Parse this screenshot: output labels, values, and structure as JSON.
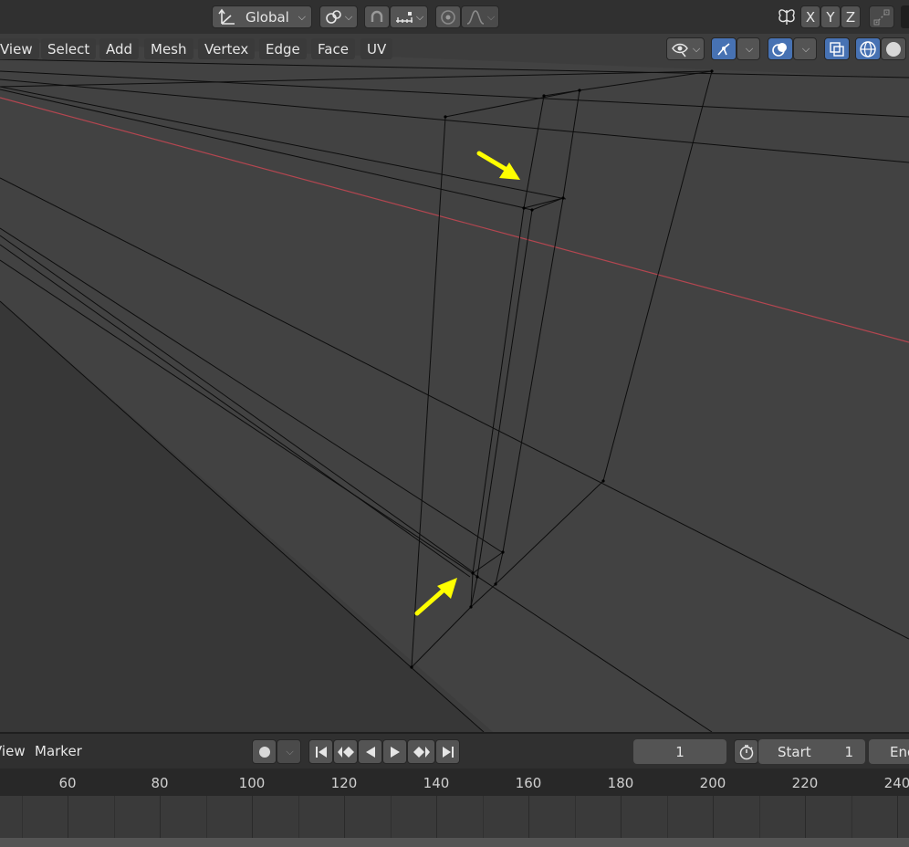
{
  "header": {
    "transform_orientation": "Global",
    "axis_x": "X",
    "axis_y": "Y",
    "axis_z": "Z"
  },
  "menu": {
    "items": [
      "View",
      "Select",
      "Add",
      "Mesh",
      "Vertex",
      "Edge",
      "Face",
      "UV"
    ]
  },
  "timeline": {
    "view_label": "View",
    "marker_label": "Marker",
    "current_frame": "1",
    "start_label": "Start",
    "start_value": "1",
    "end_label": "End",
    "ruler_ticks": [
      "60",
      "80",
      "100",
      "120",
      "140",
      "160",
      "180",
      "200",
      "220",
      "240"
    ]
  },
  "colors": {
    "x_axis_line": "#b34650",
    "annotation_arrow": "#ffff00",
    "active_button": "#4772b3"
  }
}
